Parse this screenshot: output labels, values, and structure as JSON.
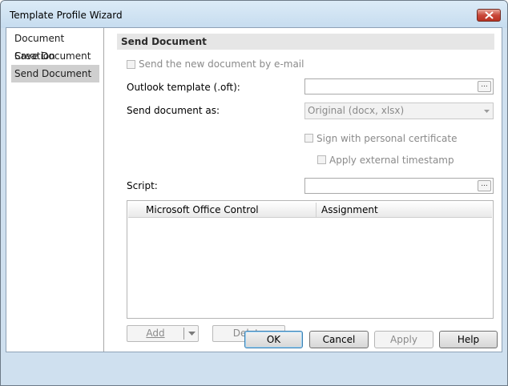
{
  "window": {
    "title": "Template Profile Wizard"
  },
  "nav": {
    "items": [
      {
        "label": "Document Creation",
        "selected": false
      },
      {
        "label": "Save Document",
        "selected": false
      },
      {
        "label": "Send Document",
        "selected": true
      }
    ]
  },
  "section": {
    "header": "Send Document",
    "send_email_label": "Send the new document by e-mail",
    "outlook_template_label": "Outlook template (.oft):",
    "outlook_template_value": "",
    "browse_label": "...",
    "send_as_label": "Send document as:",
    "send_as_value": "Original (docx, xlsx)",
    "sign_label": "Sign with personal certificate",
    "timestamp_label": "Apply external timestamp",
    "script_label": "Script:",
    "script_value": ""
  },
  "grid": {
    "columns": [
      "Microsoft Office Control",
      "Assignment"
    ],
    "rows": []
  },
  "buttons": {
    "add": "Add",
    "delete": "Delete"
  },
  "footer": {
    "ok": "OK",
    "cancel": "Cancel",
    "apply": "Apply",
    "help": "Help"
  },
  "icons": {
    "close": "close-icon",
    "dropdown": "chevron-down-icon"
  },
  "colors": {
    "close_button": "#c9483a",
    "selected_nav": "#cfcfcf",
    "window_frame": "#cfe0ef"
  }
}
